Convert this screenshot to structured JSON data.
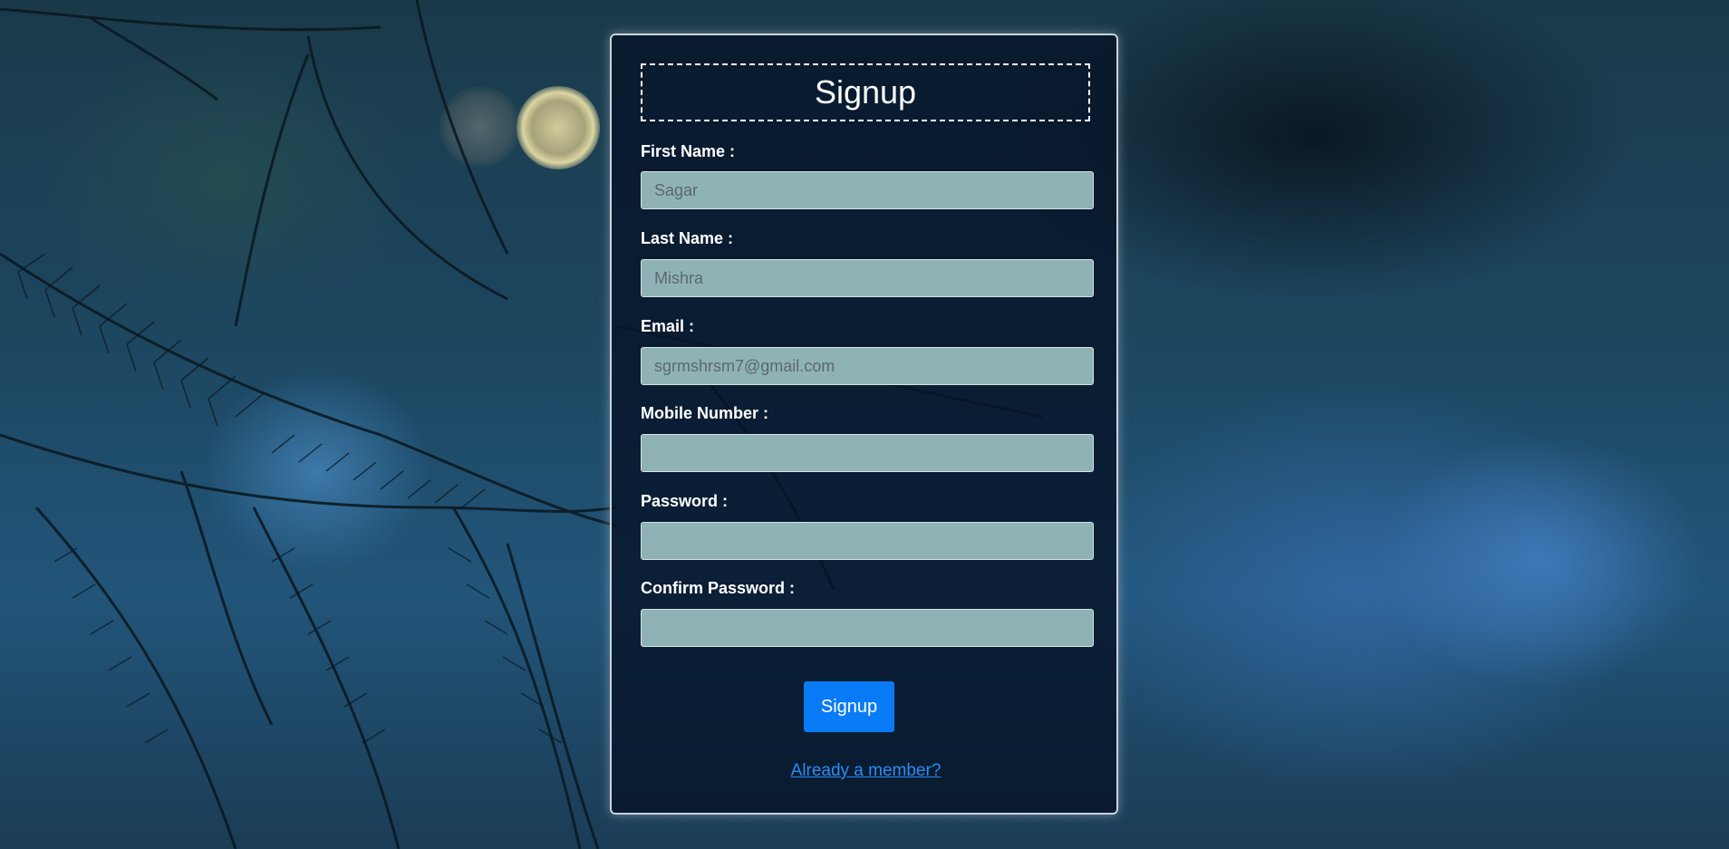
{
  "form": {
    "title": "Signup",
    "fields": [
      {
        "label": "First Name :",
        "placeholder": "Sagar",
        "type": "text"
      },
      {
        "label": "Last Name :",
        "placeholder": "Mishra",
        "type": "text"
      },
      {
        "label": "Email :",
        "placeholder": "sgrmshrsm7@gmail.com",
        "type": "email"
      },
      {
        "label": "Mobile Number :",
        "placeholder": "",
        "type": "tel"
      },
      {
        "label": "Password :",
        "placeholder": "",
        "type": "password"
      },
      {
        "label": "Confirm Password :",
        "placeholder": "",
        "type": "password"
      }
    ],
    "submit_label": "Signup",
    "login_link": "Already a member?"
  },
  "colors": {
    "button": "#0a7bf6",
    "link": "#2b8cf3",
    "input_bg": "#8fb2b5"
  }
}
